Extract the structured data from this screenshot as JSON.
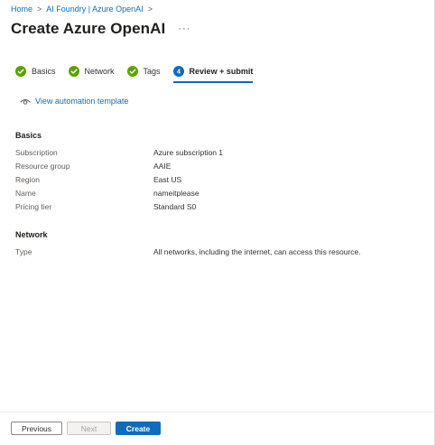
{
  "breadcrumb": {
    "items": [
      "Home",
      "AI Foundry | Azure OpenAI"
    ],
    "separator": ">"
  },
  "header": {
    "title": "Create Azure OpenAI",
    "more_label": "···"
  },
  "tabs": [
    {
      "label": "Basics",
      "status": "complete"
    },
    {
      "label": "Network",
      "status": "complete"
    },
    {
      "label": "Tags",
      "status": "complete"
    },
    {
      "label": "Review + submit",
      "status": "active",
      "step": "4"
    }
  ],
  "automation": {
    "label": "View automation template",
    "icon": "eye-icon"
  },
  "sections": {
    "basics": {
      "title": "Basics",
      "rows": [
        {
          "label": "Subscription",
          "value": "Azure subscription 1"
        },
        {
          "label": "Resource group",
          "value": "AAIE"
        },
        {
          "label": "Region",
          "value": "East US"
        },
        {
          "label": "Name",
          "value": "nameitplease"
        },
        {
          "label": "Pricing tier",
          "value": "Standard S0"
        }
      ]
    },
    "network": {
      "title": "Network",
      "rows": [
        {
          "label": "Type",
          "value": "All networks, including the internet, can access this resource."
        }
      ]
    }
  },
  "footer": {
    "previous_label": "Previous",
    "next_label": "Next",
    "create_label": "Create"
  },
  "colors": {
    "accent": "#0f6cbd",
    "success": "#57a300",
    "text": "#323130"
  }
}
